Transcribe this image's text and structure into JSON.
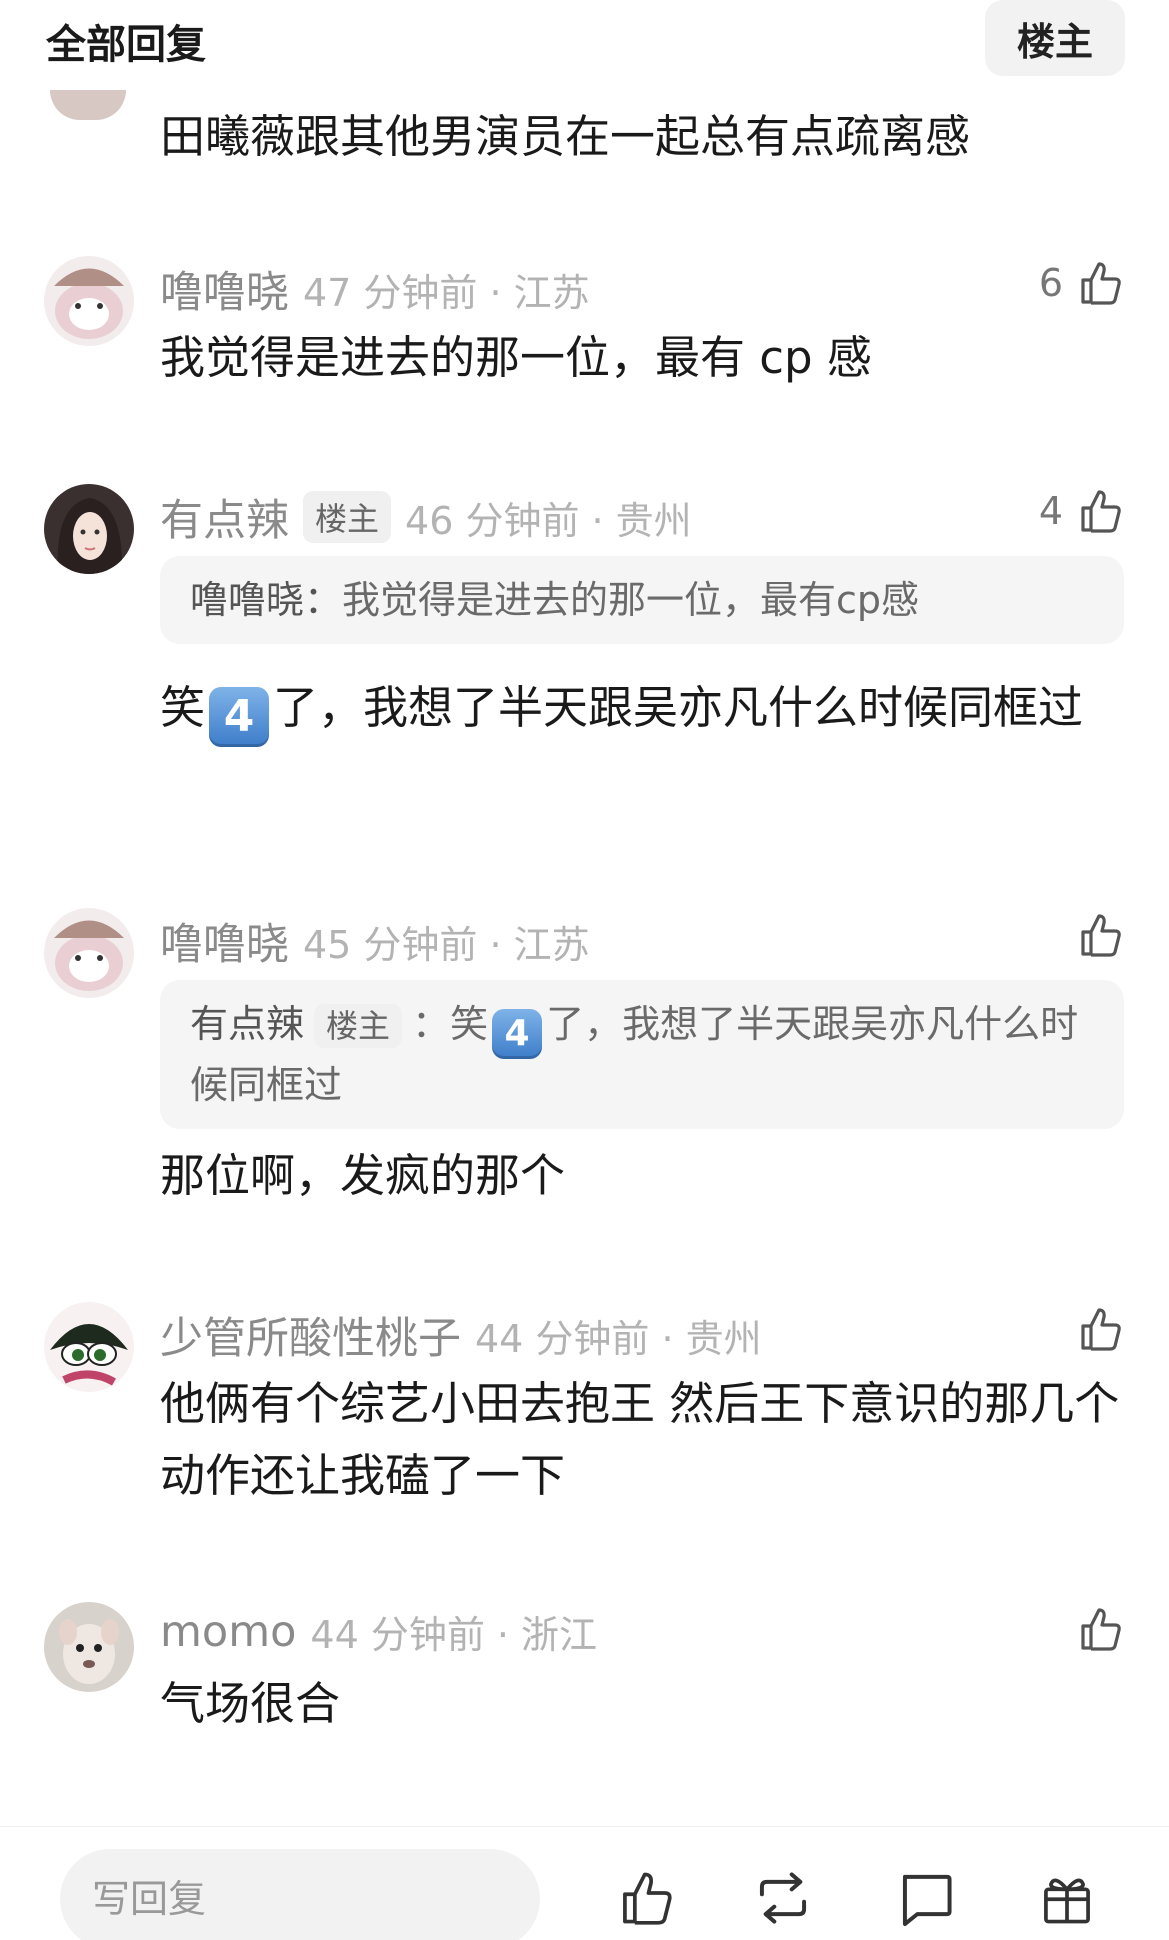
{
  "header": {
    "title": "全部回复",
    "author_button": "楼主"
  },
  "top_reply": {
    "text": "田曦薇跟其他男演员在一起总有点疏离感"
  },
  "comments": [
    {
      "username": "噜噜晓",
      "time_loc": "47 分钟前 · 江苏",
      "likes": "6",
      "text": "我觉得是进去的那一位，最有 cp 感"
    },
    {
      "username": "有点辣",
      "badge": "楼主",
      "time_loc": "46 分钟前 · 贵州",
      "likes": "4",
      "quote": {
        "name": "噜噜晓：",
        "text": "我觉得是进去的那一位，最有cp感"
      },
      "text_before_emoji": "笑",
      "emoji": "4",
      "text_after_emoji": "了，我想了半天跟吴亦凡什么时候同框过"
    },
    {
      "username": "噜噜晓",
      "time_loc": "45 分钟前 · 江苏",
      "quote": {
        "name": "有点辣",
        "badge": "楼主",
        "sep": "：",
        "before": "笑",
        "emoji": "4",
        "after": "了，我想了半天跟吴亦凡什么时候同框过"
      },
      "text": "那位啊，发疯的那个"
    },
    {
      "username": "少管所酸性桃子",
      "time_loc": "44 分钟前 · 贵州",
      "text": "他俩有个综艺小田去抱王 然后王下意识的那几个动作还让我磕了一下"
    },
    {
      "username": "momo",
      "time_loc": "44 分钟前 · 浙江",
      "text": "气场很合"
    }
  ],
  "bottom_bar": {
    "reply_placeholder": "写回复",
    "icons": [
      "thumbs-up-icon",
      "repost-icon",
      "comment-icon",
      "gift-icon"
    ]
  }
}
